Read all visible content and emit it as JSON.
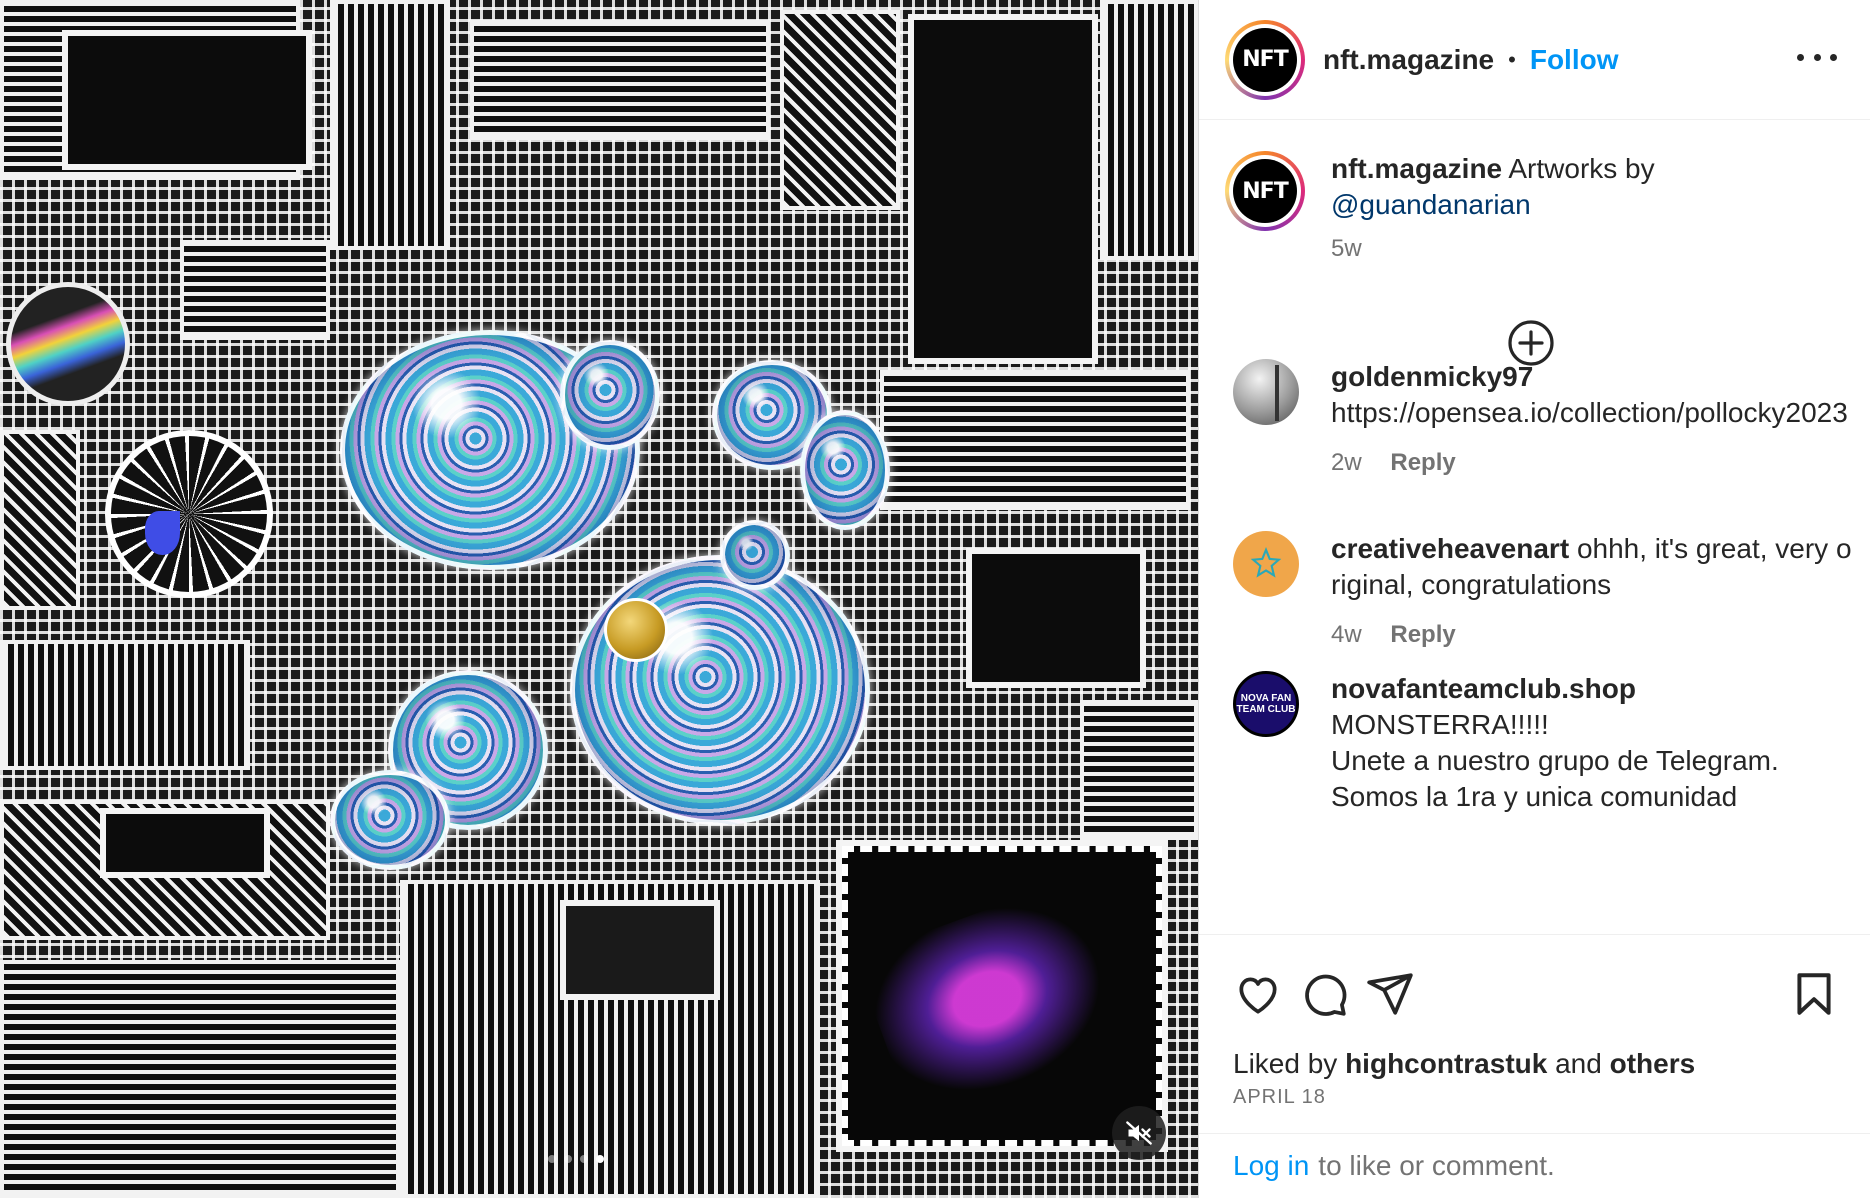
{
  "post": {
    "username": "nft.magazine",
    "separator": "•",
    "follow_label": "Follow",
    "avatar_text": "NFT"
  },
  "caption": {
    "username": "nft.magazine",
    "text": "Artworks by",
    "mention": "@guandanarian",
    "time": "5w"
  },
  "comments": [
    {
      "username": "goldenmicky97",
      "text": "https://opensea.io/collection/pollocky2023",
      "time": "2w",
      "reply_label": "Reply"
    },
    {
      "username": "creativeheavenart",
      "text": "ohhh, it's great, very original, congratulations",
      "time": "4w",
      "reply_label": "Reply"
    },
    {
      "username": "novafanteamclub.shop",
      "line1": "MONSTERRA!!!!!",
      "line2": "Unete a nuestro grupo de Telegram.",
      "line3": "Somos la 1ra y unica comunidad",
      "avatar_text": "NOVA FAN TEAM CLUB"
    }
  ],
  "likes": {
    "prefix": "Liked by",
    "user": "highcontrastuk",
    "and": "and",
    "others": "others"
  },
  "date": "APRIL 18",
  "login": {
    "link": "Log in",
    "rest": "to like or comment."
  },
  "icons": {
    "more": "more-options-icon",
    "add": "plus-circle-icon",
    "like": "heart-icon",
    "comment": "comment-icon",
    "share": "paper-plane-icon",
    "save": "bookmark-icon",
    "mute": "speaker-muted-icon"
  },
  "colors": {
    "accent": "#0095f6",
    "text": "#262626",
    "secondary": "#737373",
    "mention": "#00376b"
  }
}
